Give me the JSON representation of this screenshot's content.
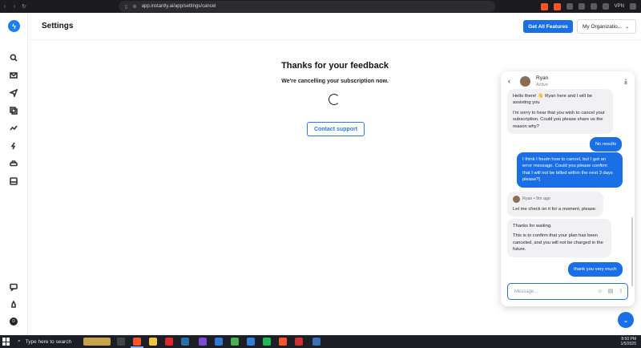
{
  "browser": {
    "url": "app.instantly.ai/app/settings/cancel",
    "vpn_label": "VPN"
  },
  "app": {
    "logo_icon": "lightning-bolt-icon",
    "page_title": "Settings",
    "get_features_label": "Get All Features",
    "org_select_value": "My Organizatio..."
  },
  "sidebar": {
    "icons": [
      "search-icon",
      "mail-icon",
      "send-icon",
      "copy-icon",
      "analytics-icon",
      "bolt-icon",
      "car-icon",
      "inbox-icon"
    ],
    "bottom_icons": [
      "chat-icon",
      "rocket-icon"
    ],
    "avatar_letter": "D"
  },
  "main": {
    "title": "Thanks for your feedback",
    "subtitle": "We're cancelling your subscription now.",
    "contact_label": "Contact support"
  },
  "chat": {
    "agent_name": "Ryan",
    "agent_status": "Active",
    "messages": [
      {
        "from": "agent",
        "lines": [
          "Hello there! 👋 Ryan here and I will be",
          "assisting you"
        ]
      },
      {
        "from": "agent",
        "lines": [
          "I'm sorry to hear that you wish to cancel your",
          "subscription. Could you please share us the",
          "reason why?"
        ]
      },
      {
        "from": "user",
        "text": "No results"
      },
      {
        "from": "user",
        "lines": [
          "I think I foudn how to cancel, but I got an",
          "error message. Could you please confirm",
          "that I will not be billed within the next 3 days",
          "please?]"
        ]
      },
      {
        "from": "agent",
        "meta": "Ryan • 9m ago",
        "lines": [
          "Let me check on it for a moment, please."
        ]
      },
      {
        "from": "agent",
        "lines": [
          "Thanks for waiting."
        ]
      },
      {
        "from": "agent",
        "lines": [
          "This is to confirm that your plan has been",
          "canceled, and you will not be charged in the",
          "future."
        ]
      },
      {
        "from": "user",
        "text": "thank you very much"
      }
    ],
    "input_placeholder": "Message..."
  },
  "taskbar": {
    "search_placeholder": "Type here to search",
    "time": "8:50 PM",
    "date": "1/5/2025"
  },
  "colors": {
    "accent": "#1a6fe7",
    "browser_bar": "#1c1c1f",
    "taskbar": "#1d1f26"
  }
}
